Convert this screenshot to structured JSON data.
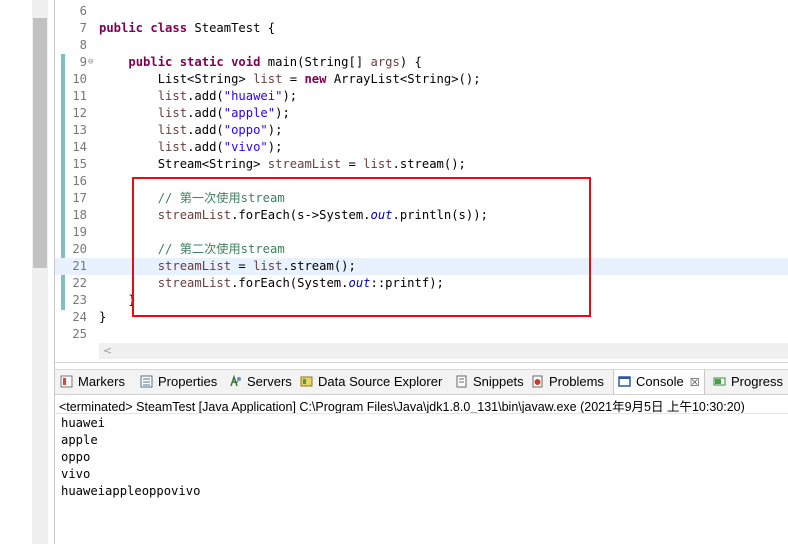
{
  "editor": {
    "lines": [
      {
        "num": "6",
        "segments": []
      },
      {
        "num": "7",
        "segments": [
          {
            "t": "public class",
            "c": "kw"
          },
          {
            "t": " SteamTest {",
            "c": ""
          }
        ]
      },
      {
        "num": "8",
        "segments": []
      },
      {
        "num": "9",
        "fold": "⊖",
        "segments": [
          {
            "t": "    ",
            "c": ""
          },
          {
            "t": "public static void",
            "c": "kw"
          },
          {
            "t": " main(String[] ",
            "c": ""
          },
          {
            "t": "args",
            "c": "var"
          },
          {
            "t": ") {",
            "c": ""
          }
        ]
      },
      {
        "num": "10",
        "segments": [
          {
            "t": "        List<String> ",
            "c": ""
          },
          {
            "t": "list",
            "c": "var"
          },
          {
            "t": " = ",
            "c": ""
          },
          {
            "t": "new",
            "c": "kw"
          },
          {
            "t": " ArrayList<String>();",
            "c": ""
          }
        ]
      },
      {
        "num": "11",
        "segments": [
          {
            "t": "        ",
            "c": ""
          },
          {
            "t": "list",
            "c": "var"
          },
          {
            "t": ".add(",
            "c": ""
          },
          {
            "t": "\"huawei\"",
            "c": "str"
          },
          {
            "t": ");",
            "c": ""
          }
        ]
      },
      {
        "num": "12",
        "segments": [
          {
            "t": "        ",
            "c": ""
          },
          {
            "t": "list",
            "c": "var"
          },
          {
            "t": ".add(",
            "c": ""
          },
          {
            "t": "\"apple\"",
            "c": "str"
          },
          {
            "t": ");",
            "c": ""
          }
        ]
      },
      {
        "num": "13",
        "segments": [
          {
            "t": "        ",
            "c": ""
          },
          {
            "t": "list",
            "c": "var"
          },
          {
            "t": ".add(",
            "c": ""
          },
          {
            "t": "\"oppo\"",
            "c": "str"
          },
          {
            "t": ");",
            "c": ""
          }
        ]
      },
      {
        "num": "14",
        "segments": [
          {
            "t": "        ",
            "c": ""
          },
          {
            "t": "list",
            "c": "var"
          },
          {
            "t": ".add(",
            "c": ""
          },
          {
            "t": "\"vivo\"",
            "c": "str"
          },
          {
            "t": ");",
            "c": ""
          }
        ]
      },
      {
        "num": "15",
        "segments": [
          {
            "t": "        Stream<String> ",
            "c": ""
          },
          {
            "t": "streamList",
            "c": "var"
          },
          {
            "t": " = ",
            "c": ""
          },
          {
            "t": "list",
            "c": "var"
          },
          {
            "t": ".stream();",
            "c": ""
          }
        ]
      },
      {
        "num": "16",
        "segments": []
      },
      {
        "num": "17",
        "segments": [
          {
            "t": "        // 第一次使用stream",
            "c": "cmt"
          }
        ]
      },
      {
        "num": "18",
        "segments": [
          {
            "t": "        ",
            "c": ""
          },
          {
            "t": "streamList",
            "c": "var"
          },
          {
            "t": ".forEach(s->System.",
            "c": ""
          },
          {
            "t": "out",
            "c": "fld"
          },
          {
            "t": ".println(s));",
            "c": ""
          }
        ]
      },
      {
        "num": "19",
        "segments": []
      },
      {
        "num": "20",
        "segments": [
          {
            "t": "        // 第二次使用stream",
            "c": "cmt"
          }
        ]
      },
      {
        "num": "21",
        "hl": true,
        "segments": [
          {
            "t": "        ",
            "c": ""
          },
          {
            "t": "streamList",
            "c": "var"
          },
          {
            "t": " = ",
            "c": ""
          },
          {
            "t": "list",
            "c": "var"
          },
          {
            "t": ".stream();",
            "c": ""
          }
        ]
      },
      {
        "num": "22",
        "segments": [
          {
            "t": "        ",
            "c": ""
          },
          {
            "t": "streamList",
            "c": "var"
          },
          {
            "t": ".forEach(System.",
            "c": ""
          },
          {
            "t": "out",
            "c": "fld"
          },
          {
            "t": "::printf);",
            "c": ""
          }
        ]
      },
      {
        "num": "23",
        "segments": [
          {
            "t": "    }",
            "c": ""
          }
        ]
      },
      {
        "num": "24",
        "segments": [
          {
            "t": "}",
            "c": ""
          }
        ]
      },
      {
        "num": "25",
        "segments": []
      }
    ],
    "scroll_arrow": "<"
  },
  "tabs": {
    "markers": "Markers",
    "properties": "Properties",
    "servers": "Servers",
    "data_source_explorer": "Data Source Explorer",
    "snippets": "Snippets",
    "problems": "Problems",
    "console": "Console",
    "console_close": "☒",
    "progress": "Progress"
  },
  "console": {
    "header": "<terminated> SteamTest [Java Application] C:\\Program Files\\Java\\jdk1.8.0_131\\bin\\javaw.exe (2021年9月5日 上午10:30:20)",
    "output": [
      "huawei",
      "apple",
      "oppo",
      "vivo",
      "huaweiappleoppovivo"
    ]
  },
  "colors": {
    "keyword": "#7f0055",
    "string": "#2a00ff",
    "comment": "#3f7f5f",
    "highlight_box": "#e01010"
  }
}
